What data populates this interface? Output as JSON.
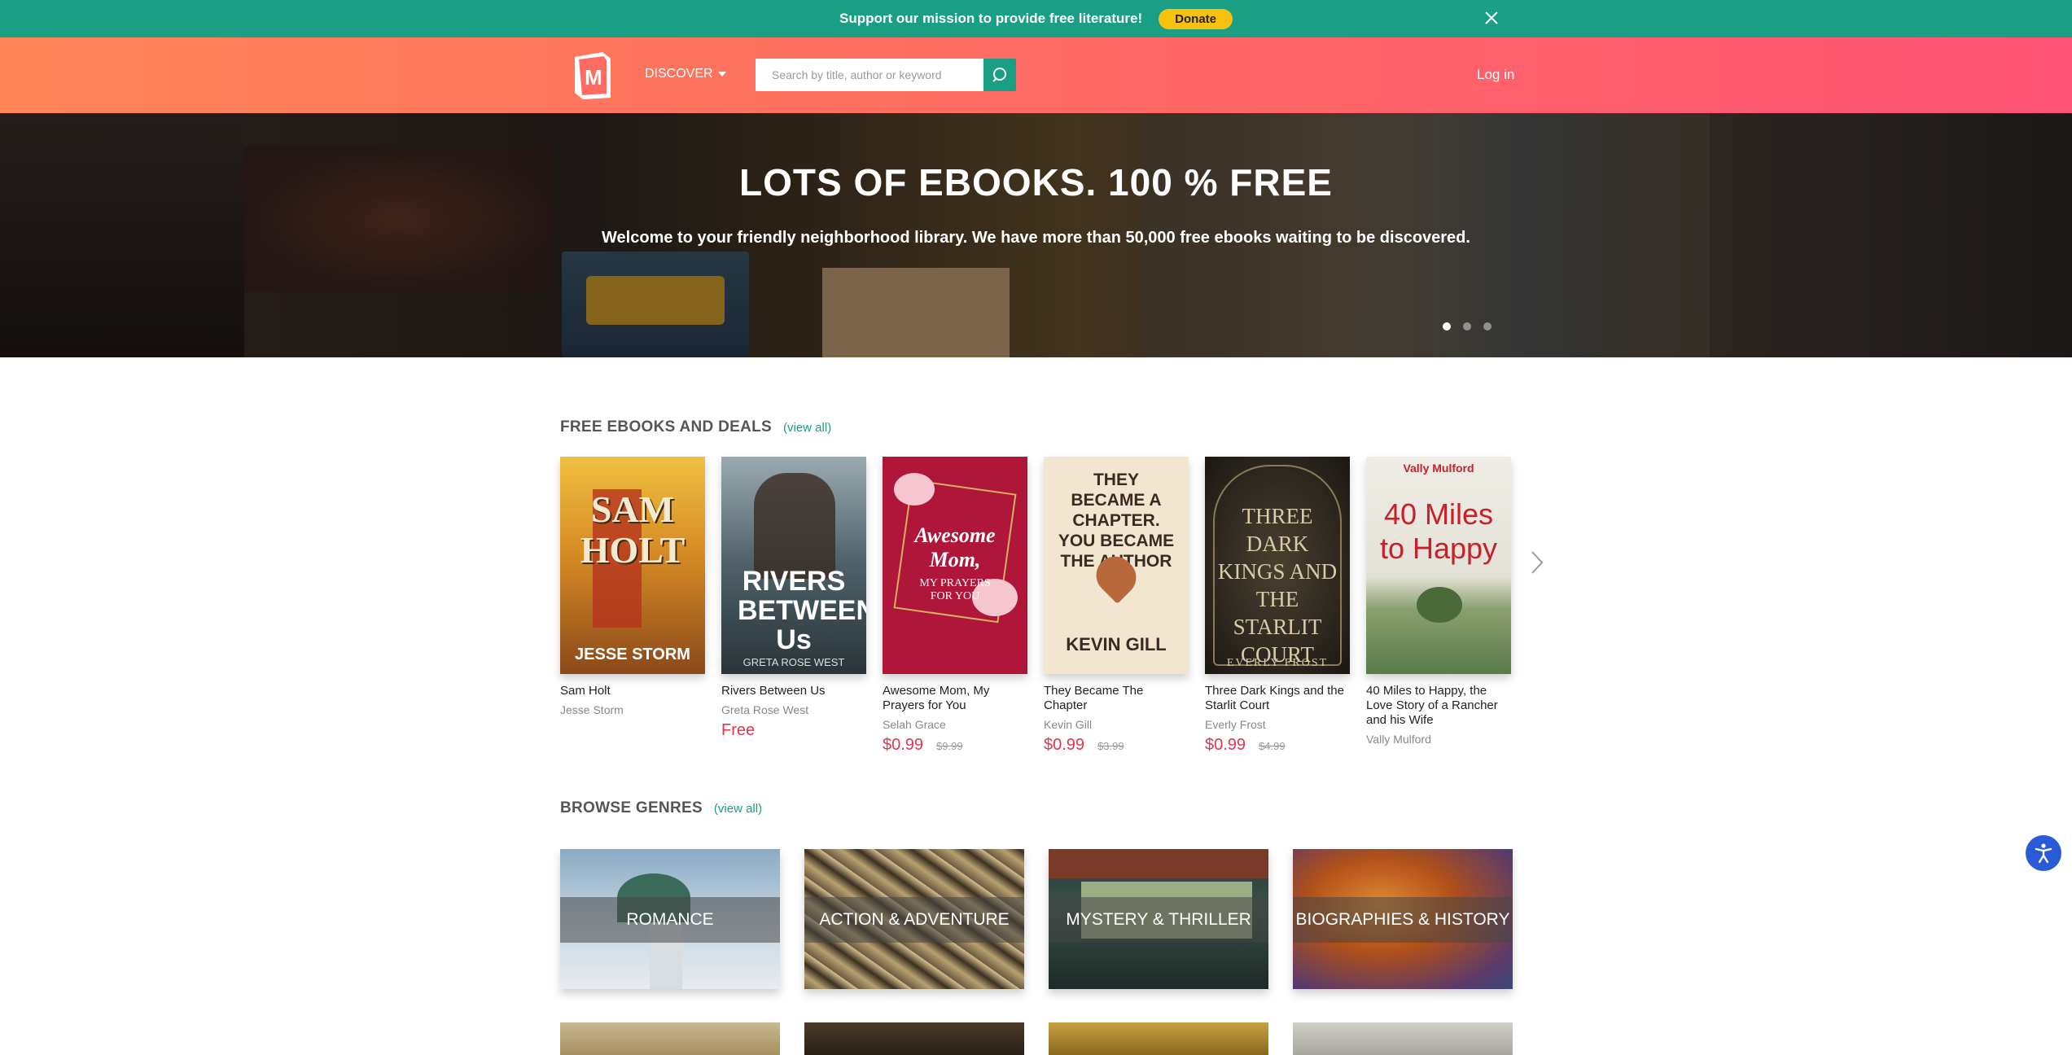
{
  "banner": {
    "message": "Support our mission to provide free literature!",
    "donate_label": "Donate"
  },
  "header": {
    "discover_label": "DISCOVER",
    "search_placeholder": "Search by title, author or keyword",
    "login_label": "Log in",
    "logo_letter": "M"
  },
  "hero": {
    "title": "LOTS OF EBOOKS. 100 % FREE",
    "subtitle": "Welcome to your friendly neighborhood library. We have more than 50,000 free ebooks waiting to be discovered.",
    "slide_count": 3,
    "active_slide": 1
  },
  "free_section": {
    "title": "FREE EBOOKS AND DEALS",
    "view_all": "(view all)",
    "books": [
      {
        "title": "Sam Holt",
        "author": "Jesse Storm",
        "price": "",
        "old_price": "",
        "cover_text": "SAM HOLT",
        "cover_author": "JESSE STORM",
        "cover_color": "#d68a24"
      },
      {
        "title": "Rivers Between Us",
        "author": "Greta Rose West",
        "price": "Free",
        "old_price": "",
        "cover_text": "RIVERS BETWEEN Us",
        "cover_author": "GRETA ROSE WEST",
        "cover_color": "#4d6068"
      },
      {
        "title": "Awesome Mom, My Prayers for You",
        "author": "Selah Grace",
        "price": "$0.99",
        "old_price": "$9.99",
        "cover_text": "Awesome Mom,",
        "cover_author": "MY PRAYERS FOR YOU",
        "cover_color": "#b0163a"
      },
      {
        "title": "They Became The Chapter",
        "author": "Kevin Gill",
        "price": "$0.99",
        "old_price": "$3.99",
        "cover_text": "THEY BECAME A CHAPTER. YOU BECAME THE AUTHOR",
        "cover_author": "KEVIN GILL",
        "cover_color": "#f3e6d0"
      },
      {
        "title": "Three Dark Kings and the Starlit Court",
        "author": "Everly Frost",
        "price": "$0.99",
        "old_price": "$4.99",
        "cover_text": "THREE DARK KINGS AND THE STARLIT COURT",
        "cover_author": "EVERLY FROST",
        "cover_color": "#2e2820"
      },
      {
        "title": "40 Miles to Happy, the Love Story of a Rancher and his Wife",
        "author": "Vally Mulford",
        "price": "",
        "old_price": "",
        "cover_text": "40 Miles to Happy",
        "cover_author": "Vally Mulford",
        "cover_color": "#e8e6dc"
      }
    ]
  },
  "genre_section": {
    "title": "BROWSE GENRES",
    "view_all": "(view all)",
    "genres": [
      {
        "label": "ROMANCE"
      },
      {
        "label": "ACTION & ADVENTURE"
      },
      {
        "label": "MYSTERY & THRILLER"
      },
      {
        "label": "BIOGRAPHIES & HISTORY"
      }
    ]
  },
  "colors": {
    "teal": "#1a9e84",
    "coral": "#ff6a62",
    "price_red": "#e0364f",
    "donate_yellow": "#f7c20e"
  },
  "icons": {
    "close": "close-icon",
    "search": "search-icon",
    "next": "chevron-right-icon",
    "accessibility": "accessibility-icon"
  }
}
